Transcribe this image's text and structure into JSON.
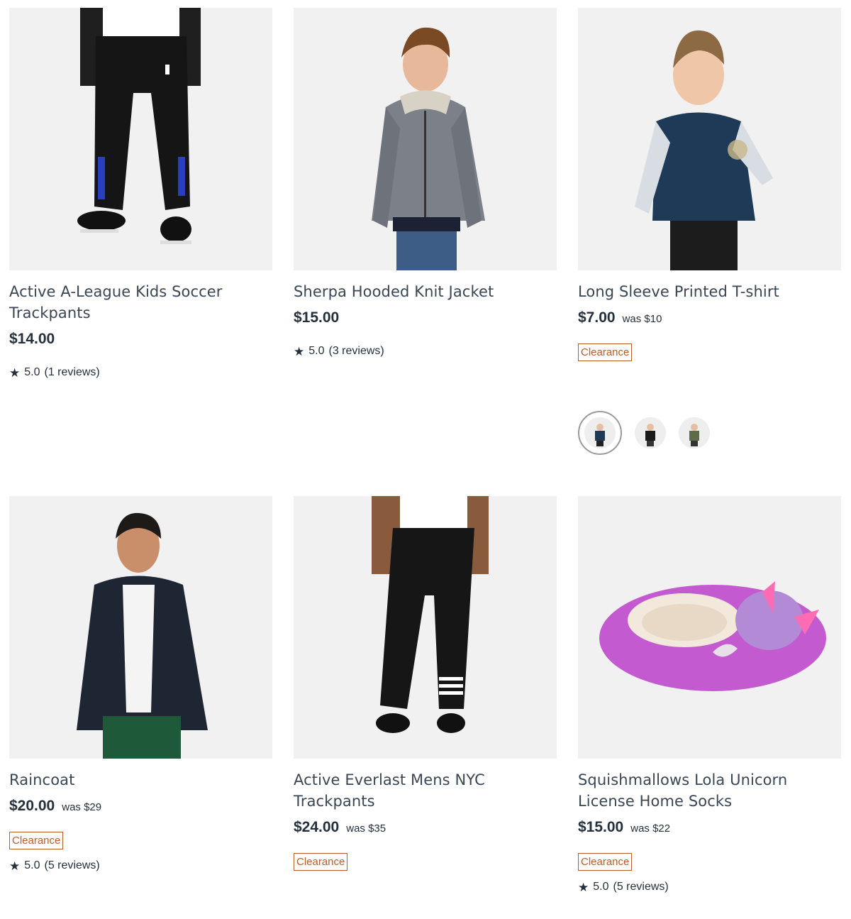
{
  "products": [
    {
      "title": "Active A-League Kids Soccer Trackpants",
      "price": "$14.00",
      "rating": "5.0",
      "reviews": "(1 reviews)",
      "image": "kids-black-trackpants"
    },
    {
      "title": "Sherpa Hooded Knit Jacket",
      "price": "$15.00",
      "rating": "5.0",
      "reviews": "(3 reviews)",
      "image": "boy-grey-knit-jacket"
    },
    {
      "title": "Long Sleeve Printed T-shirt",
      "price": "$7.00",
      "was": "was $10",
      "badge": "Clearance",
      "image": "boy-navy-longsleeve-tshirt",
      "swatches": [
        "navy",
        "black",
        "olive"
      ]
    },
    {
      "title": "Raincoat",
      "price": "$20.00",
      "was": "was $29",
      "badge": "Clearance",
      "rating": "5.0",
      "reviews": "(5 reviews)",
      "image": "boy-navy-raincoat"
    },
    {
      "title": "Active Everlast Mens NYC Trackpants",
      "price": "$24.00",
      "was": "was $35",
      "badge": "Clearance",
      "image": "mens-black-trackpants"
    },
    {
      "title": "Squishmallows Lola Unicorn License Home Socks",
      "price": "$15.00",
      "was": "was $22",
      "badge": "Clearance",
      "rating": "5.0",
      "reviews": "(5 reviews)",
      "image": "purple-unicorn-slipper"
    }
  ],
  "colors": {
    "price": "#24303c",
    "title": "#3b4653",
    "badge": "#b85c2b",
    "image_bg": "#f1f1f1"
  }
}
